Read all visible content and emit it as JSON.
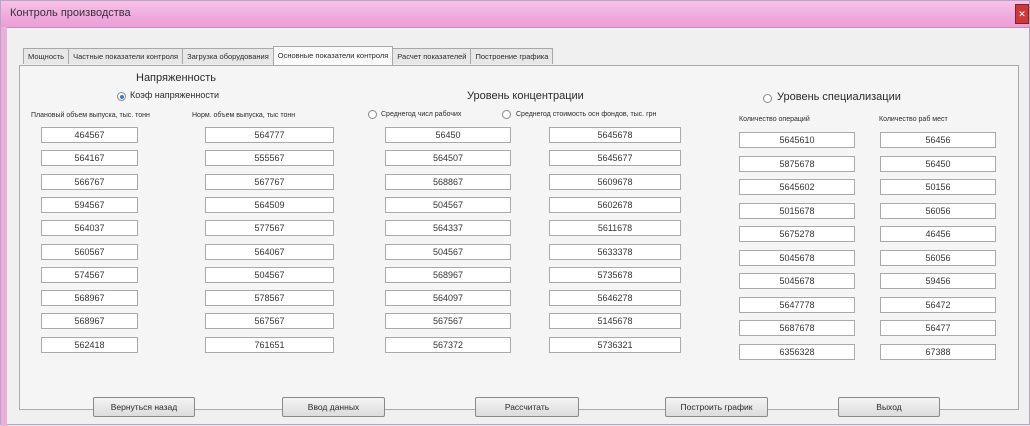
{
  "window": {
    "title": "Контроль производства",
    "close_glyph": "✕"
  },
  "tabs": [
    {
      "label": "Мощность"
    },
    {
      "label": "Частные показатели контроля"
    },
    {
      "label": "Загрузка оборудования"
    },
    {
      "label": "Основные показатели контроля"
    },
    {
      "label": "Расчет показателей"
    },
    {
      "label": "Построение графика"
    }
  ],
  "active_tab": 3,
  "groups": {
    "intensity": {
      "title": "Напряженность",
      "radio_label": "Коэф напряженности",
      "col1_header": "Плановый объем выпуска, тыс. тонн",
      "col2_header": "Норм. объем выпуска, тыс тонн"
    },
    "concentration": {
      "title": "Уровень концентрации",
      "radio1_label": "Среднегод числ рабочих",
      "radio2_label": "Среднегод стоимость осн фондов, тыс. грн"
    },
    "specialization": {
      "title": "Уровень специализации",
      "col1_header": "Количество операций",
      "col2_header": "Количество раб мест"
    }
  },
  "columns": {
    "planned_output": [
      "464567",
      "564167",
      "566767",
      "594567",
      "564037",
      "560567",
      "574567",
      "568967",
      "568967",
      "562418"
    ],
    "norm_output": [
      "564777",
      "555567",
      "567767",
      "564509",
      "577567",
      "564067",
      "504567",
      "578567",
      "567567",
      "761651"
    ],
    "avg_workers": [
      "56450",
      "564507",
      "568867",
      "504567",
      "564337",
      "504567",
      "568967",
      "564097",
      "567567",
      "567372"
    ],
    "avg_funds": [
      "5645678",
      "5645677",
      "5609678",
      "5602678",
      "5611678",
      "5633378",
      "5735678",
      "5646278",
      "5145678",
      "5736321"
    ],
    "operations": [
      "5645610",
      "5875678",
      "5645602",
      "5015678",
      "5675278",
      "5045678",
      "5045678",
      "5647778",
      "5687678",
      "6356328"
    ],
    "workplaces": [
      "56456",
      "56450",
      "50156",
      "56056",
      "46456",
      "56056",
      "59456",
      "56472",
      "56477",
      "67388"
    ]
  },
  "buttons": {
    "back": "Вернуться назад",
    "input": "Ввод данных",
    "calculate": "Рассчитать",
    "plot": "Построить график",
    "exit": "Выход"
  }
}
